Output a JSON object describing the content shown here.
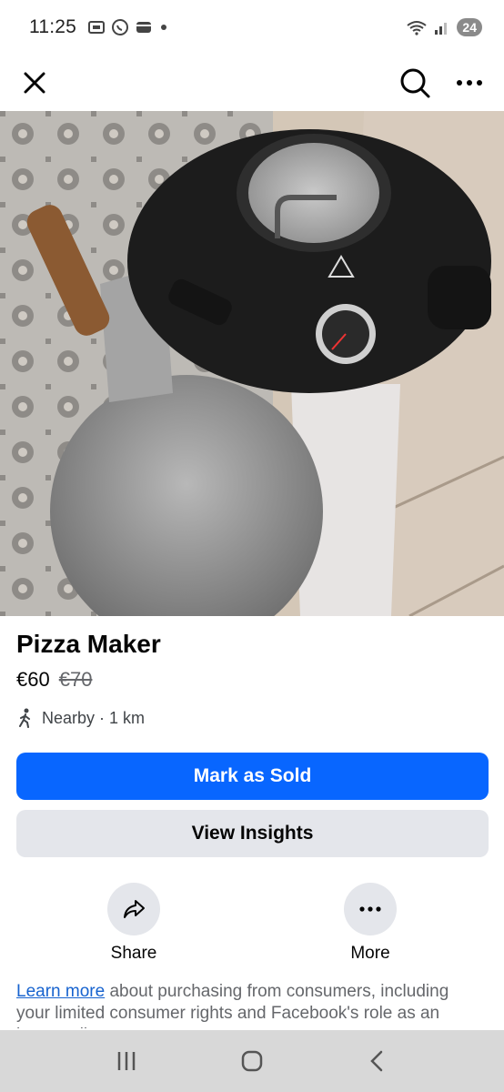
{
  "status_bar": {
    "time": "11:25",
    "battery_level": "24",
    "icons": [
      "screenshot-icon",
      "whatsapp-icon",
      "wallet-icon",
      "dot-icon",
      "wifi-icon",
      "signal-icon"
    ]
  },
  "top_bar": {
    "close_icon": "close-icon",
    "search_icon": "search-icon",
    "more_icon": "more-icon"
  },
  "photo": {
    "pager_count": 3,
    "pager_active_index": 1
  },
  "listing": {
    "title": "Pizza Maker",
    "price": "€60",
    "original_price": "€70",
    "location": "Nearby · 1 km"
  },
  "buttons": {
    "mark_sold": "Mark as Sold",
    "view_insights": "View Insights"
  },
  "actions": {
    "share_label": "Share",
    "more_label": "More"
  },
  "info": {
    "link_text": "Learn more",
    "text": " about purchasing from consumers, including your limited consumer rights and Facebook's role as an intermediary."
  },
  "colors": {
    "primary": "#0866ff",
    "secondary_bg": "#e4e6eb",
    "link": "#1763cf"
  }
}
